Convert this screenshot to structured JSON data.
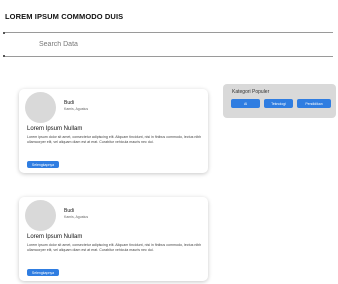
{
  "page": {
    "heading": "LOREM IPSUM COMMODO DUIS"
  },
  "search": {
    "placeholder": "Search Data",
    "value": ""
  },
  "posts": [
    {
      "author": "Budi",
      "meta": "Kamis, Agustus",
      "title": "Lorem Ipsum Nullam",
      "body": "Lorem ipsum dolor sit amet, consectetur adipiscing elit. Aliquam tincidunt, nisi in finibus commodo, lectus nibh ullamcorper elit, vel aliquam diam est at erat. Curabitur vehicula mauris nec dui.",
      "button": "Selengkapnya"
    },
    {
      "author": "Budi",
      "meta": "Kamis, Agustus",
      "title": "Lorem Ipsum Nullam",
      "body": "Lorem ipsum dolor sit amet, consectetur adipiscing elit. Aliquam tincidunt, nisi in finibus commodo, lectus nibh ullamcorper elit, vel aliquam diam est at erat. Curabitur vehicula mauris nec dui.",
      "button": "Selengkapnya"
    }
  ],
  "categories": {
    "title": "Kategori Populer",
    "items": [
      "Al",
      "Teknologi",
      "Pendidikan"
    ]
  },
  "colors": {
    "accent": "#2f7de1",
    "panel": "#d9d9d9"
  }
}
